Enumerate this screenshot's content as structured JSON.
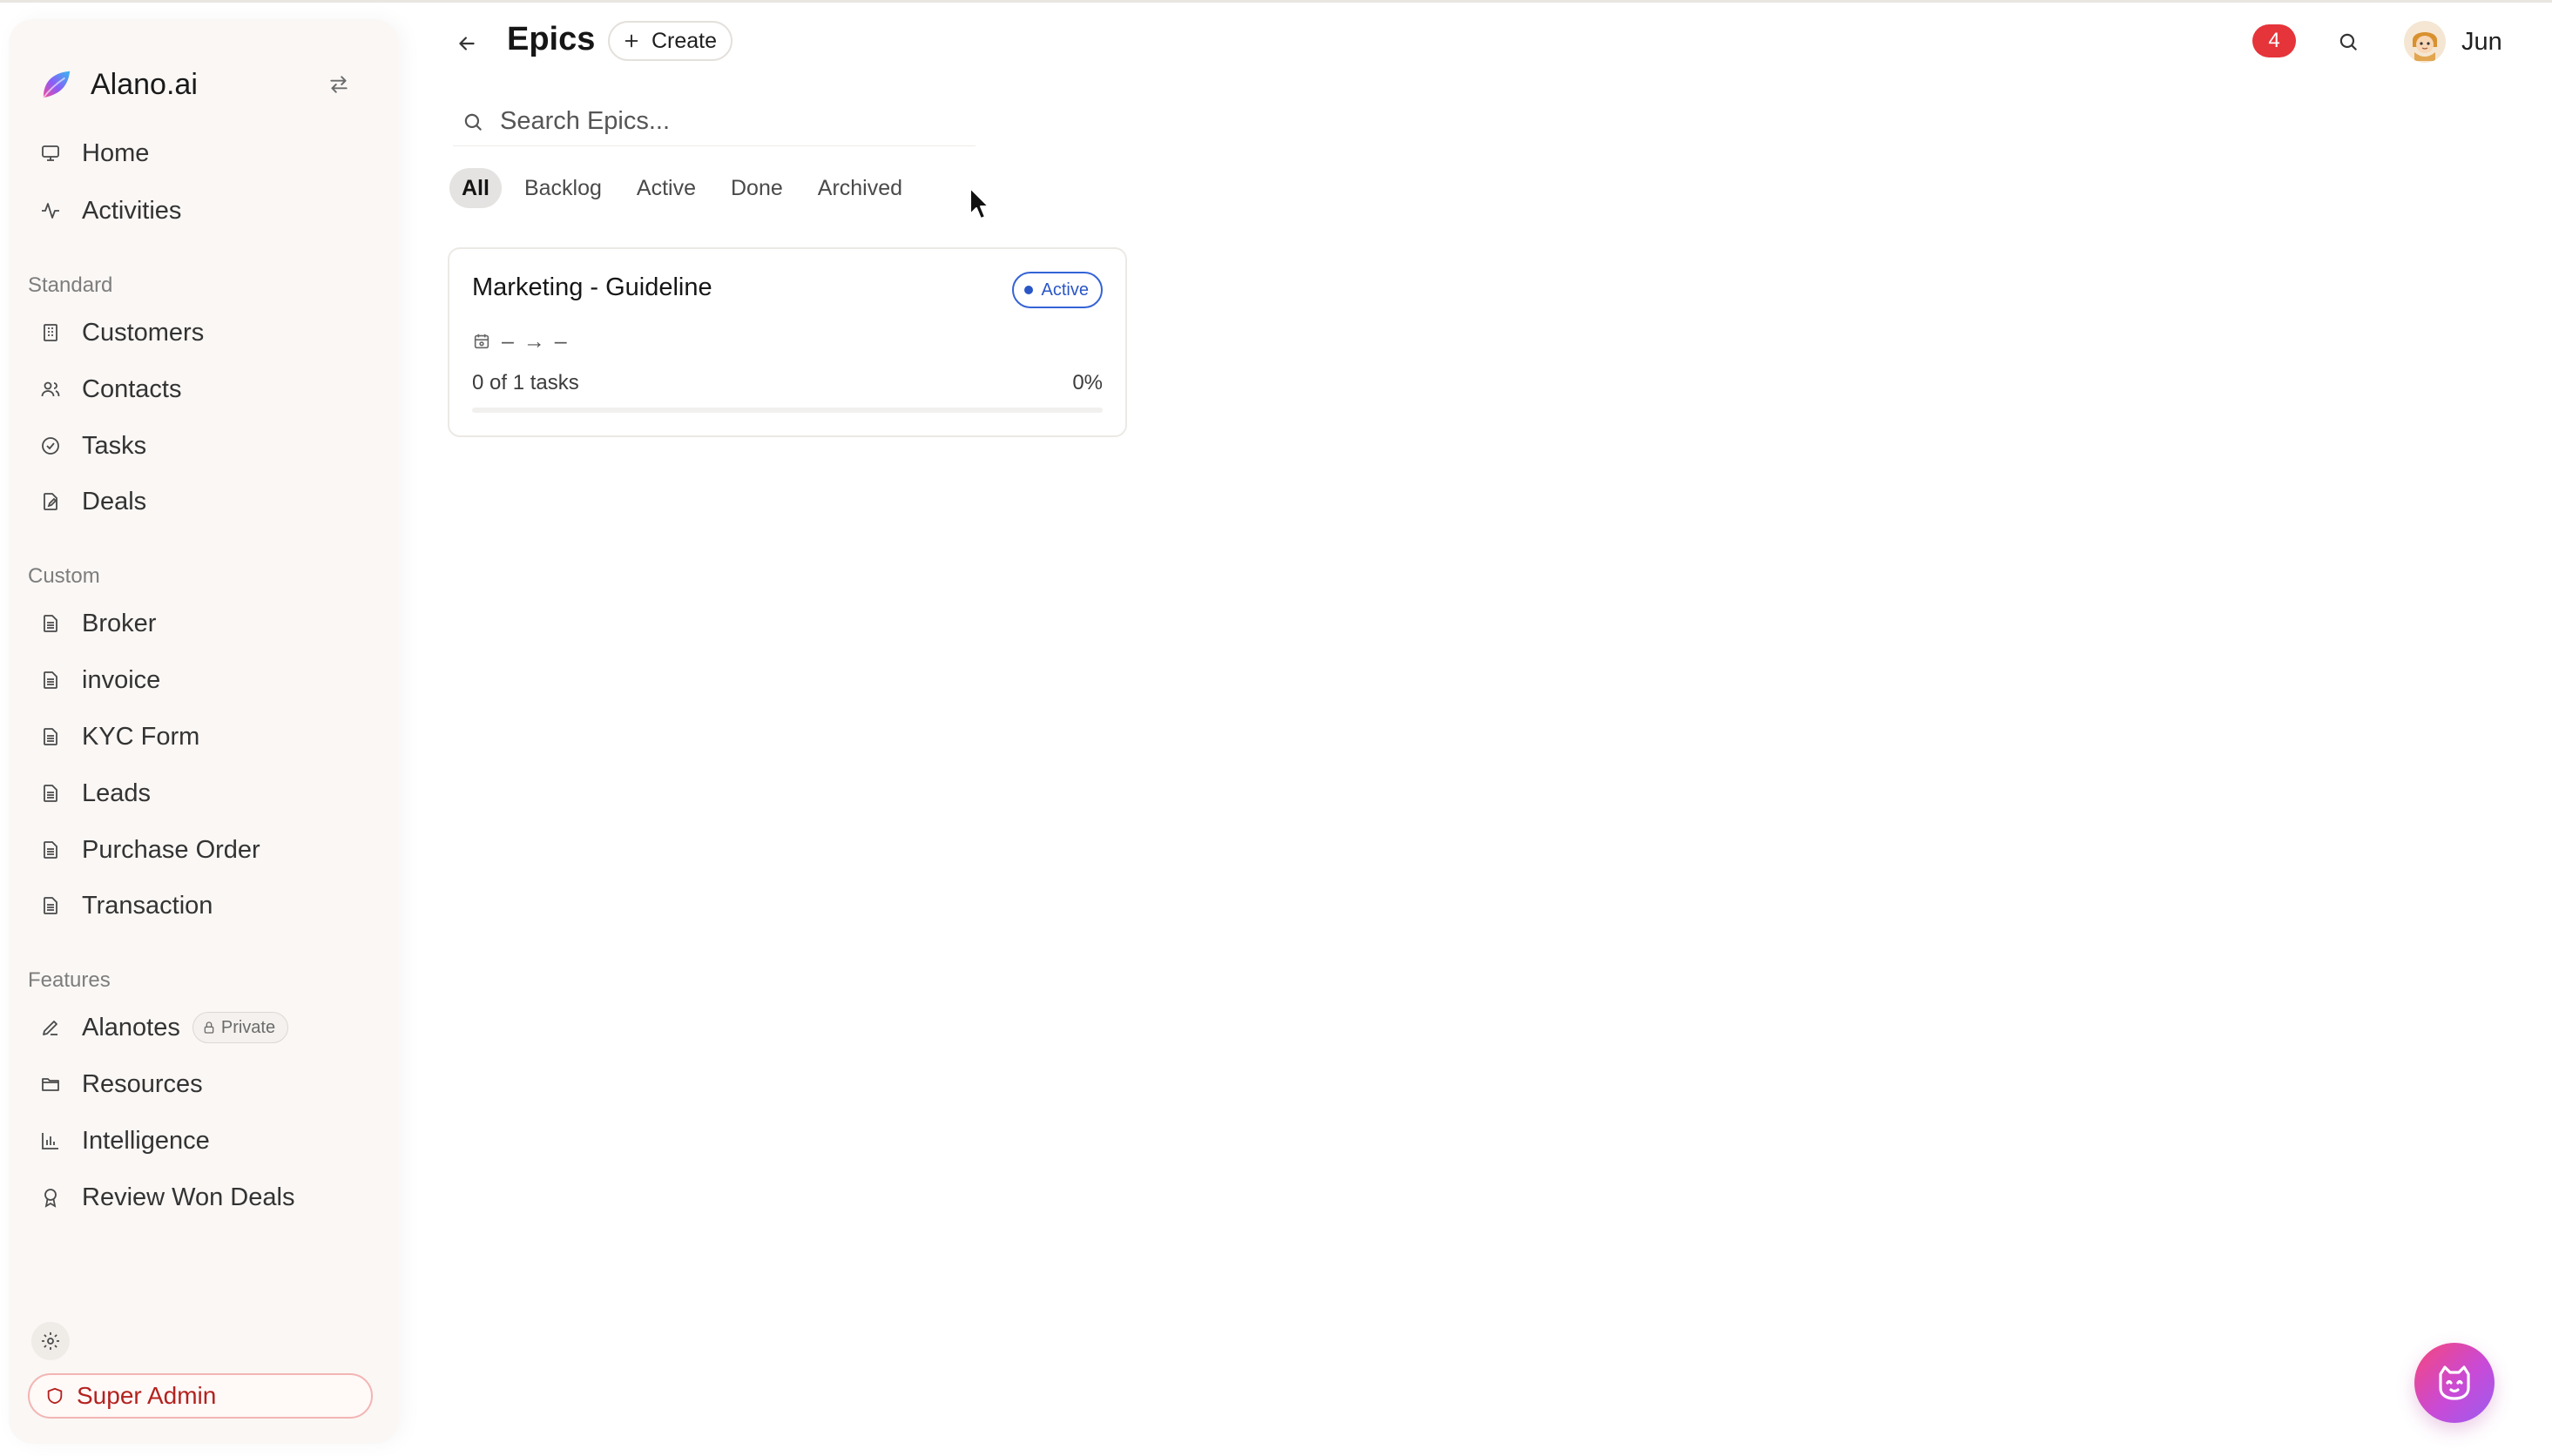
{
  "brand": {
    "name": "Alano.ai"
  },
  "sidebar": {
    "top_items": [
      {
        "label": "Home",
        "icon": "monitor-icon"
      },
      {
        "label": "Activities",
        "icon": "activity-icon"
      }
    ],
    "sections": {
      "standard": "Standard",
      "custom": "Custom",
      "features": "Features"
    },
    "standard_items": [
      {
        "label": "Customers",
        "icon": "building-icon"
      },
      {
        "label": "Contacts",
        "icon": "users-icon"
      },
      {
        "label": "Tasks",
        "icon": "check-circle-icon"
      },
      {
        "label": "Deals",
        "icon": "file-edit-icon"
      }
    ],
    "custom_items": [
      {
        "label": "Broker",
        "icon": "document-icon"
      },
      {
        "label": "invoice",
        "icon": "document-icon"
      },
      {
        "label": "KYC Form",
        "icon": "document-icon"
      },
      {
        "label": "Leads",
        "icon": "document-icon"
      },
      {
        "label": "Purchase Order",
        "icon": "document-icon"
      },
      {
        "label": "Transaction",
        "icon": "document-icon"
      }
    ],
    "feature_items": [
      {
        "label": "Alanotes",
        "icon": "pen-icon",
        "badge": "Private"
      },
      {
        "label": "Resources",
        "icon": "folder-icon"
      },
      {
        "label": "Intelligence",
        "icon": "bar-chart-icon"
      },
      {
        "label": "Review Won Deals",
        "icon": "award-icon"
      }
    ],
    "super_admin_label": "Super Admin"
  },
  "header": {
    "title": "Epics",
    "create_label": "Create",
    "notification_count": "4",
    "user_name": "Jun"
  },
  "search": {
    "placeholder": "Search Epics..."
  },
  "tabs": [
    {
      "label": "All",
      "active": true
    },
    {
      "label": "Backlog",
      "active": false
    },
    {
      "label": "Active",
      "active": false
    },
    {
      "label": "Done",
      "active": false
    },
    {
      "label": "Archived",
      "active": false
    }
  ],
  "epics": [
    {
      "title": "Marketing - Guideline",
      "status": "Active",
      "dates": "– → –",
      "tasks_text": "0 of 1 tasks",
      "percent_text": "0%",
      "progress": 0
    }
  ],
  "colors": {
    "accent": "#3463d6",
    "danger": "#e5343a",
    "sidebar_bg": "#faf7f5"
  }
}
